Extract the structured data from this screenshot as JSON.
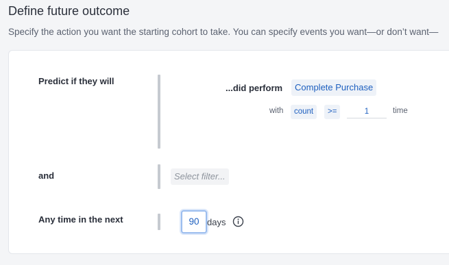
{
  "section": {
    "title": "Define future outcome",
    "description": "Specify the action you want the starting cohort to take. You can specify events you want—or don’t want—"
  },
  "rows": {
    "predict_label": "Predict if they will",
    "and_label": "and",
    "time_label": "Any time in the next"
  },
  "event_condition": {
    "action_label": "...did perform",
    "event_name": "Complete Purchase",
    "with_label": "with",
    "metric": "count",
    "operator": ">=",
    "value": "1",
    "unit_label": "time"
  },
  "filter": {
    "placeholder": "Select filter..."
  },
  "time_window": {
    "value": "90",
    "unit": "days"
  },
  "icons": {
    "info": "info-circle-icon"
  }
}
